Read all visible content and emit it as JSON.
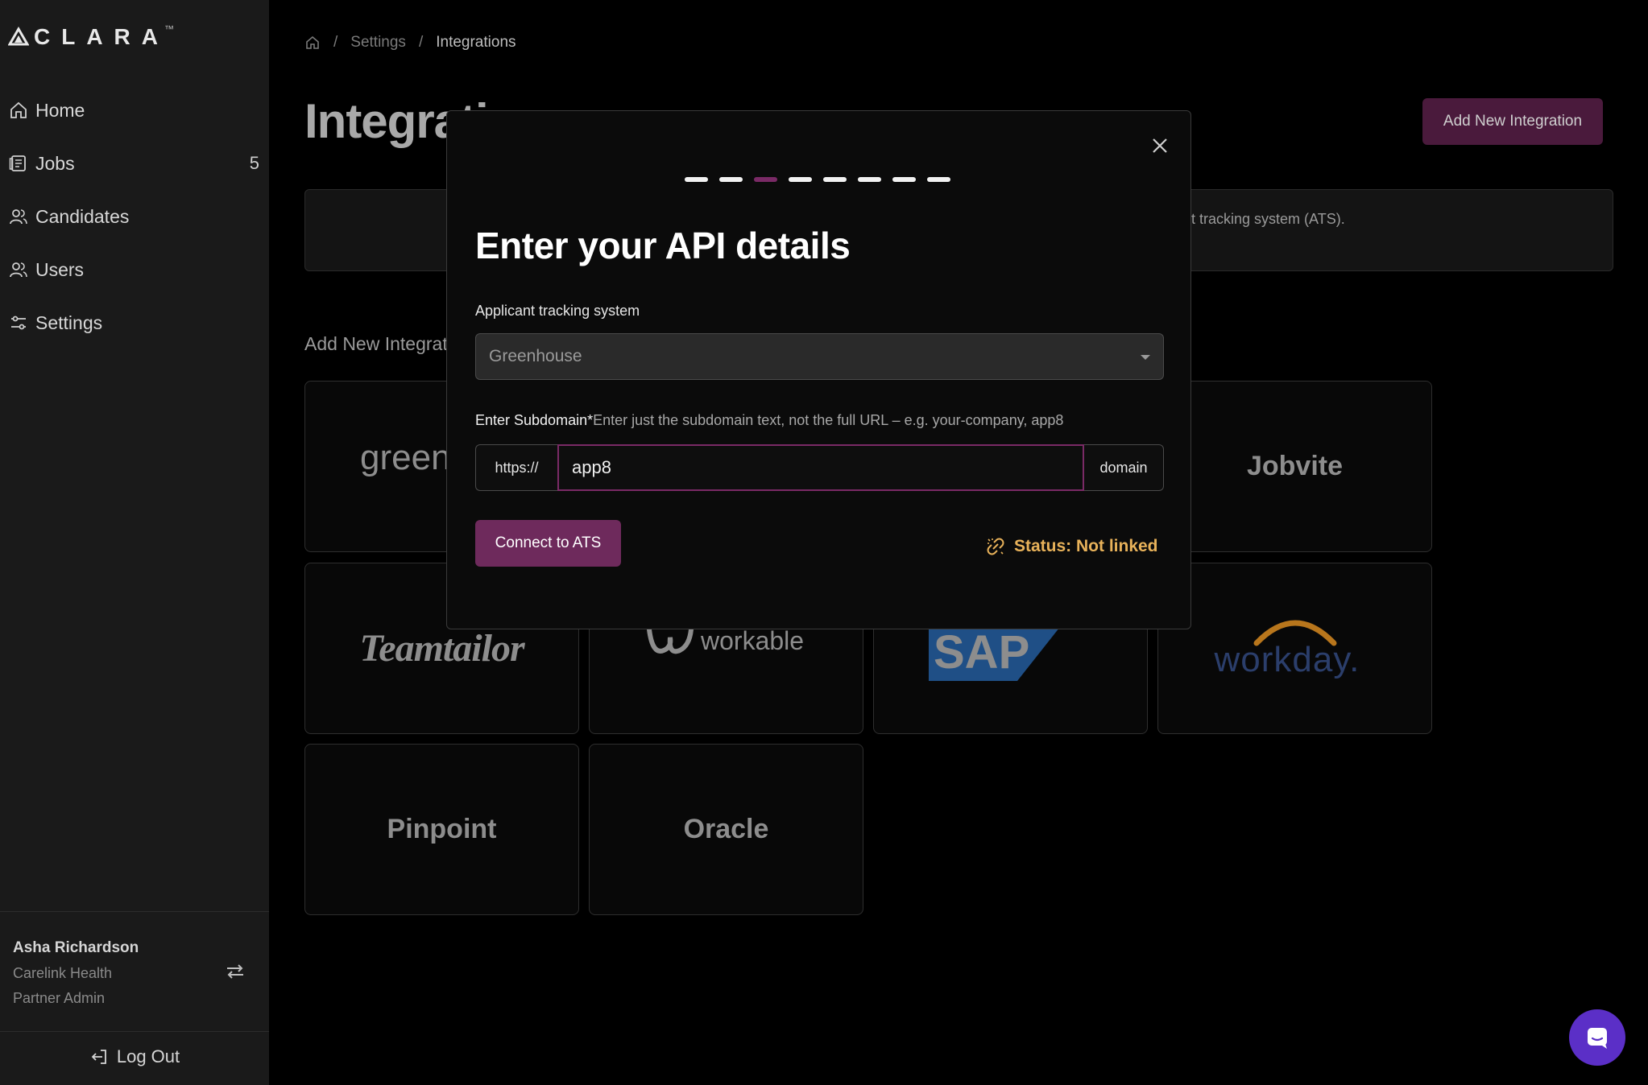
{
  "app": {
    "logo_text": "CLARA",
    "logo_tm": "™"
  },
  "sidebar": {
    "items": [
      {
        "label": "Home",
        "icon": "home-icon"
      },
      {
        "label": "Jobs",
        "icon": "jobs-icon",
        "count": "5"
      },
      {
        "label": "Candidates",
        "icon": "candidates-icon"
      },
      {
        "label": "Users",
        "icon": "users-icon"
      },
      {
        "label": "Settings",
        "icon": "settings-icon"
      }
    ],
    "user": {
      "name": "Asha Richardson",
      "organization": "Carelink Health",
      "role": "Partner Admin"
    },
    "logout_label": "Log Out"
  },
  "breadcrumb": {
    "separator": "/",
    "items": [
      "Settings",
      "Integrations"
    ]
  },
  "page": {
    "title": "Integrations",
    "add_button_label": "Add New Integration",
    "info_text": "nt tracking system (ATS).",
    "section_title": "Add New Integrations"
  },
  "integrations": {
    "greenhouse": "greenhouse",
    "jobvite": "Jobvite",
    "teamtailor": "Teamtailor",
    "workable": "workable",
    "sap": "SAP",
    "workday": "workday.",
    "pinpoint": "Pinpoint",
    "oracle": "Oracle"
  },
  "modal": {
    "steps_total": 8,
    "active_step": 3,
    "title": "Enter your API details",
    "ats_label": "Applicant tracking system",
    "ats_value": "Greenhouse",
    "subdomain_label": "Enter Subdomain*",
    "subdomain_hint": "Enter just the subdomain text, not the full URL – e.g. your-company, app8",
    "prefix": "https://",
    "subdomain_value": "app8",
    "suffix": "domain",
    "connect_label": "Connect to ATS",
    "status_text": "Status: Not linked"
  },
  "colors": {
    "accent": "#6e2a5c",
    "status": "#e8b25a",
    "chat": "#5b2fc7"
  }
}
